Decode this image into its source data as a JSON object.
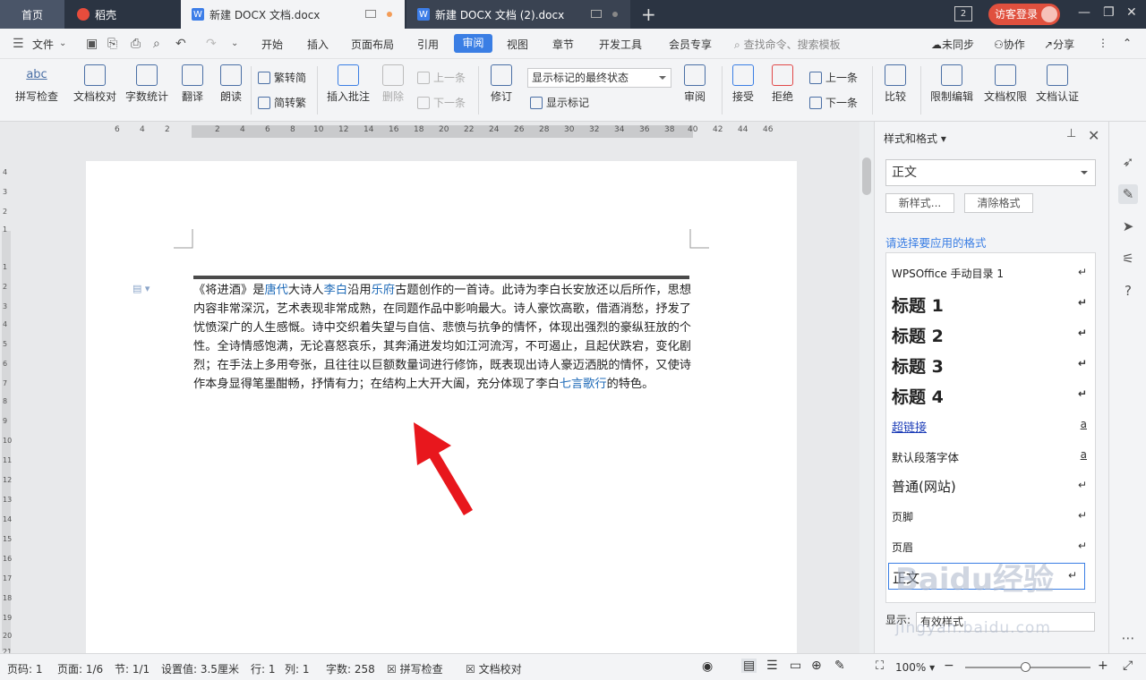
{
  "tabs": {
    "home": "首页",
    "wps": "稻壳",
    "active_doc": "新建 DOCX 文档.docx",
    "doc2": "新建 DOCX 文档 (2).docx",
    "window_count": "2",
    "login": "访客登录"
  },
  "menubar": {
    "file": "文件",
    "items": [
      "开始",
      "插入",
      "页面布局",
      "引用",
      "审阅",
      "视图",
      "章节",
      "开发工具",
      "会员专享"
    ],
    "active": "审阅",
    "search": "查找命令、搜索模板",
    "sync": "未同步",
    "collab": "协作",
    "share": "分享"
  },
  "ribbon": {
    "spell_icon_text": "abc",
    "spell": "拼写检查",
    "proofread": "文档校对",
    "wordcount": "字数统计",
    "translate": "翻译",
    "read": "朗读",
    "trad": "繁转简",
    "simp": "简转繁",
    "insert_comment": "插入批注",
    "delete": "删除",
    "prev_comment": "上一条",
    "next_comment": "下一条",
    "track": "修订",
    "markup_state": "显示标记的最终状态",
    "show_markup": "显示标记",
    "review": "审阅",
    "accept": "接受",
    "reject": "拒绝",
    "prev_change": "上一条",
    "next_change": "下一条",
    "compare": "比较",
    "restrict": "限制编辑",
    "permission": "文档权限",
    "certify": "文档认证"
  },
  "ruler_numbers": [
    "6",
    "4",
    "2",
    "2",
    "4",
    "6",
    "8",
    "10",
    "12",
    "14",
    "16",
    "18",
    "20",
    "22",
    "24",
    "26",
    "28",
    "30",
    "32",
    "34",
    "36",
    "38",
    "40",
    "42",
    "44",
    "46"
  ],
  "vruler_numbers": [
    "4",
    "3",
    "2",
    "1",
    "1",
    "2",
    "3",
    "4",
    "5",
    "6",
    "7",
    "8",
    "9",
    "10",
    "11",
    "12",
    "13",
    "14",
    "15",
    "16",
    "17",
    "18",
    "19",
    "20",
    "21"
  ],
  "document": {
    "p_a": "《将进酒》是",
    "link1": "唐代",
    "p_b": "大诗人",
    "link2": "李白",
    "p_c": "沿用",
    "link3": "乐府",
    "p_d": "古题创作的一首诗。此诗为李白长安放还以后所作，思想内容非常深沉，艺术表现非常成熟，在同题作品中影响最大。诗人豪饮高歌，借酒消愁，抒发了忧愤深广的人生感慨。诗中交织着失望与自信、悲愤与抗争的情怀，体现出强烈的豪纵狂放的个性。全诗情感饱满，无论喜怒哀乐，其奔涌迸发均如江河流泻，不可遏止，且起伏跌宕，变化剧烈；在手法上多用夸张，且往往以巨额数量词进行修饰，既表现出诗人豪迈洒脱的情怀，又使诗作本身显得笔墨酣畅，抒情有力；在结构上大开大阖，充分体现了李白",
    "link4": "七言歌行",
    "p_e": "的特色。"
  },
  "panel": {
    "title": "样式和格式",
    "current": "正文",
    "new_style": "新样式...",
    "clear": "清除格式",
    "prompt": "请选择要应用的格式",
    "styles": [
      "WPSOffice 手动目录 1",
      "标题 1",
      "标题 2",
      "标题 3",
      "标题 4",
      "超链接",
      "默认段落字体",
      "普通(网站)",
      "页脚",
      "页眉",
      "正文"
    ],
    "show_label": "显示:",
    "show_value": "有效样式"
  },
  "status": {
    "pagenum": "页码: 1",
    "pages": "页面: 1/6",
    "section": "节: 1/1",
    "setting": "设置值: 3.5厘米",
    "row": "行: 1",
    "col": "列: 1",
    "words": "字数: 258",
    "spell": "拼写检查",
    "proof": "文档校对",
    "zoom": "100%"
  },
  "watermark": {
    "brand": "Baidu经验",
    "url": "jingyan.baidu.com"
  },
  "colors": {
    "accent": "#3a7ee4",
    "link": "#1f6bb8",
    "arrow": "#e8171d",
    "tabbar": "#2b3442"
  }
}
